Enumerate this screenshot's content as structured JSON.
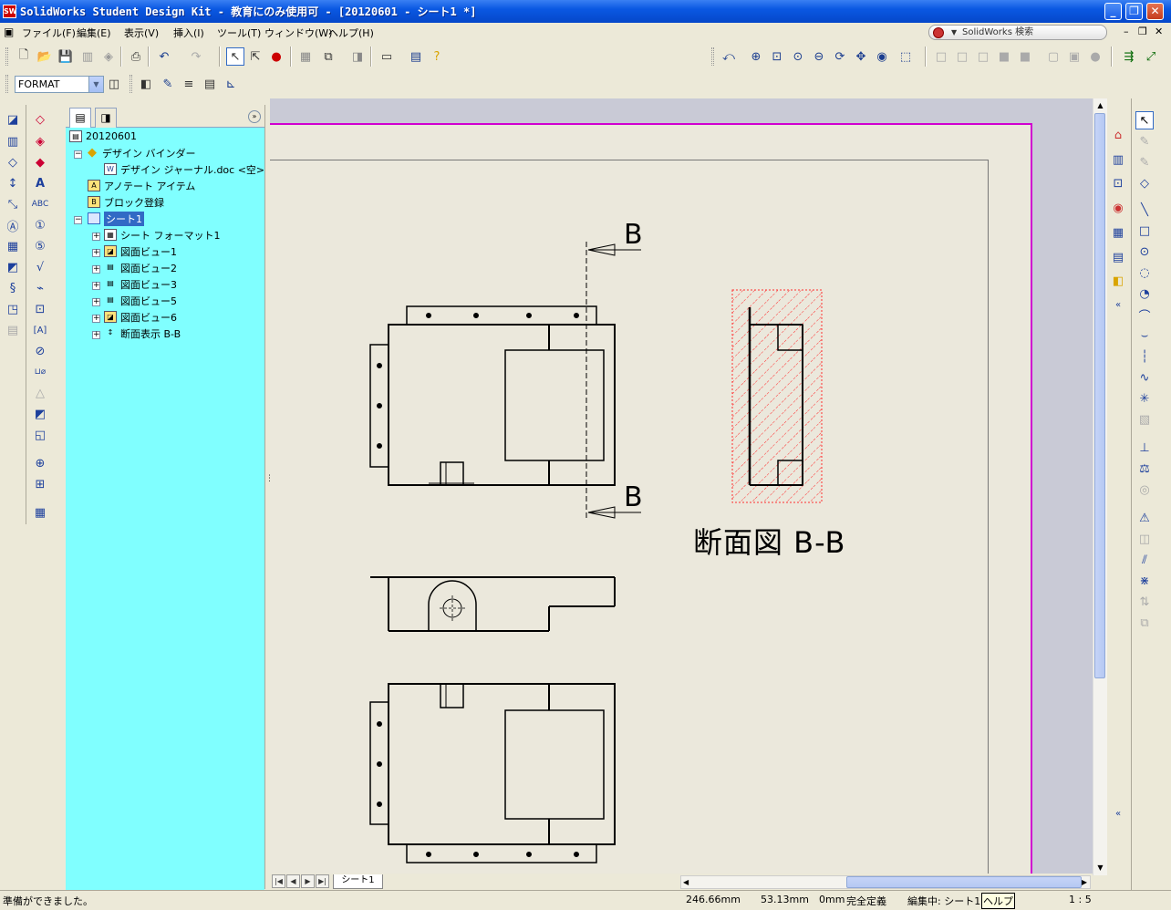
{
  "window": {
    "title": "SolidWorks Student Design Kit - 教育にのみ使用可 - [20120601 - シート1 *]",
    "logo": "SW"
  },
  "menu": [
    "ファイル(F)",
    "編集(E)",
    "表示(V)",
    "挿入(I)",
    "ツール(T)",
    "ウィンドウ(W)",
    "ヘルプ(H)"
  ],
  "search": {
    "placeholder": "SolidWorks 検索"
  },
  "format": {
    "value": "FORMAT"
  },
  "tree": {
    "root": "20120601",
    "items": [
      {
        "label": "デザイン バインダー",
        "level": 1,
        "expand": "−"
      },
      {
        "label": "デザイン ジャーナル.doc <空>",
        "level": 2,
        "expand": ""
      },
      {
        "label": "アノテート アイテム",
        "level": 1,
        "expand": ""
      },
      {
        "label": "ブロック登録",
        "level": 1,
        "expand": ""
      },
      {
        "label": "シート1",
        "level": 1,
        "expand": "−"
      },
      {
        "label": "シート フォーマット1",
        "level": 2,
        "expand": "+"
      },
      {
        "label": "図面ビュー1",
        "level": 2,
        "expand": "+"
      },
      {
        "label": "図面ビュー2",
        "level": 2,
        "expand": "+"
      },
      {
        "label": "図面ビュー3",
        "level": 2,
        "expand": "+"
      },
      {
        "label": "図面ビュー5",
        "level": 2,
        "expand": "+"
      },
      {
        "label": "図面ビュー6",
        "level": 2,
        "expand": "+"
      },
      {
        "label": "断面表示 B-B",
        "level": 2,
        "expand": "+"
      }
    ]
  },
  "drawing": {
    "section_letter_top": "B",
    "section_letter_bottom": "B",
    "section_title": "断面図 B-B"
  },
  "sheet_tab": "シート1",
  "status": {
    "message": "準備ができました。",
    "x": "246.66mm",
    "y": "53.13mm",
    "z": "0mm",
    "definition": "完全定義",
    "editing": "編集中: シート1",
    "help_tip": "ヘルプ",
    "scale": "1 : 5"
  },
  "colors": {
    "sheet_border": "#d000d0",
    "tree_background": "#80ffff",
    "hatch": "#ff3030"
  }
}
